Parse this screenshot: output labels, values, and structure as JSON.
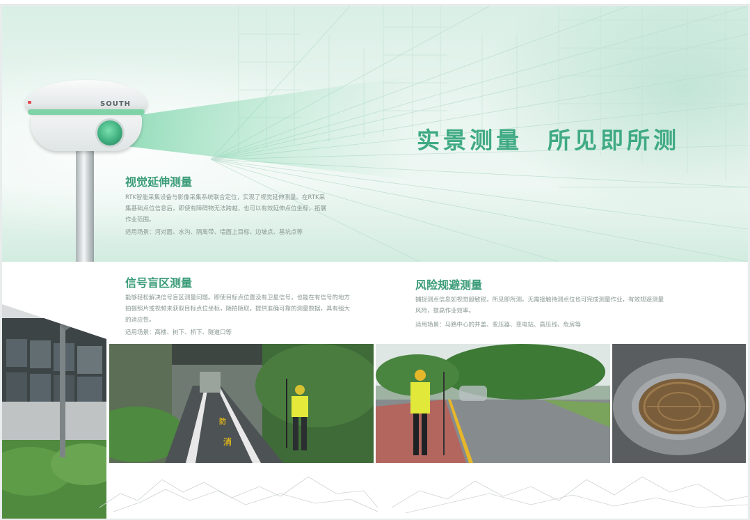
{
  "hero": {
    "slogan_part1": "实景测量",
    "slogan_part2": "所见即所测",
    "device_brand": "SOUTH",
    "title": "视觉延伸测量",
    "description": "RTK智能采集设备与影像采集系统联合定位，实现了视觉延伸测量。在RTK采集基础点位信息后，即使有障碍物无法跨越，也可以有效延伸点位坐标，拓展作业范围。",
    "scene": "适用场景：河对面、水沟、隔离带、墙面上目标、边坡点、基坑点等"
  },
  "section_blind": {
    "title": "信号盲区测量",
    "description": "能够轻松解决信号盲区测量问题。即使目标点位置没有卫星信号，也能在有信号的地方拍摄照片或视频来获取目标点位坐标，随拍随取，提供准确可靠的测量数据，具有强大的适应性。",
    "scene": "适用场景：高楼、树下、桥下、隧道口等"
  },
  "section_risk": {
    "title": "风险规避测量",
    "description": "捕捉测点信息如视觉般敏锐，所见即所测。无需接触待测点位也可完成测量作业，有效规避测量风险，提高作业效率。",
    "scene": "适用场景：马路中心的井盖、变压器、变电站、高压线、危房等"
  },
  "photos": {
    "road_marking": [
      "消",
      "防"
    ]
  },
  "colors": {
    "accent": "#3faa84",
    "title": "#3b9c79",
    "body_text": "#8a9894"
  }
}
